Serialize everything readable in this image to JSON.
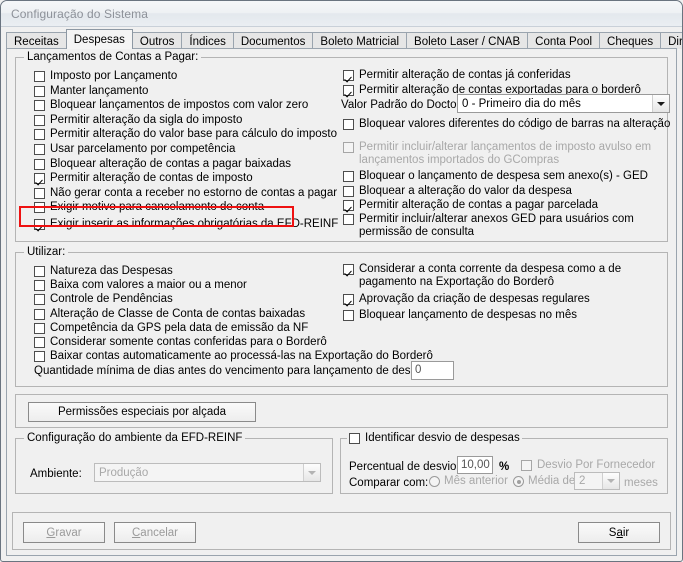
{
  "window": {
    "title": "Configuração do Sistema"
  },
  "tabs": [
    {
      "label": "Receitas",
      "active": false
    },
    {
      "label": "Despesas",
      "active": true
    },
    {
      "label": "Outros",
      "active": false
    },
    {
      "label": "Índices",
      "active": false
    },
    {
      "label": "Documentos",
      "active": false
    },
    {
      "label": "Boleto Matricial",
      "active": false
    },
    {
      "label": "Boleto Laser / CNAB",
      "active": false
    },
    {
      "label": "Conta Pool",
      "active": false
    },
    {
      "label": "Cheques",
      "active": false
    },
    {
      "label": "Diretórios",
      "active": false
    }
  ],
  "group_lancamentos": {
    "legend": "Lançamentos de Contas a Pagar:",
    "left_checkboxes": [
      {
        "label": "Imposto por Lançamento",
        "checked": false
      },
      {
        "label": "Manter lançamento",
        "checked": false
      },
      {
        "label": "Bloquear lançamentos de impostos com valor zero",
        "checked": false
      },
      {
        "label": "Permitir alteração da sigla do imposto",
        "checked": false
      },
      {
        "label": "Permitir alteração do valor base para cálculo do imposto",
        "checked": false
      },
      {
        "label": "Usar parcelamento por competência",
        "checked": false
      },
      {
        "label": "Bloquear alteração de contas a pagar baixadas",
        "checked": false
      },
      {
        "label": "Permitir alteração de contas de imposto",
        "checked": true
      },
      {
        "label": "Não gerar conta a receber no estorno de contas a pagar",
        "checked": false
      },
      {
        "label": "Exigir motivo para cancelamento de conta",
        "checked": false
      }
    ],
    "highlighted_checkbox": {
      "label": "Exigir inserir as informações obrigatórias da EFD-REINF",
      "checked": true
    },
    "right_checkboxes_top": [
      {
        "label": "Permitir alteração de contas já conferidas",
        "checked": true
      },
      {
        "label": "Permitir alteração de contas exportadas para o borderô",
        "checked": true
      }
    ],
    "valor_padrao_label": "Valor Padrão do Docto.",
    "valor_padrao_value": "0 - Primeiro dia do mês",
    "bloquear_valores": {
      "label": "Bloquear valores diferentes do código de barras na alteração",
      "checked": false
    },
    "gcompras": {
      "line1": "Permitir incluir/alterar lançamentos de imposto avulso em",
      "line2": "lançamentos importados do GCompras",
      "checked": false,
      "disabled": true
    },
    "right_checkboxes_bottom": [
      {
        "label": "Bloquear o lançamento de despesa sem anexo(s) - GED",
        "checked": false
      },
      {
        "label": "Bloquear a alteração do valor da despesa",
        "checked": false
      },
      {
        "label": "Permitir alteração de contas a pagar parcelada",
        "checked": true
      }
    ],
    "anexos_ged": {
      "line1": "Permitir incluir/alterar anexos GED para usuários com",
      "line2": "permissão de consulta",
      "checked": false
    }
  },
  "group_utilizar": {
    "legend": "Utilizar:",
    "left_checkboxes": [
      {
        "label": "Natureza das Despesas",
        "checked": false
      },
      {
        "label": "Baixa com valores a maior ou a menor",
        "checked": false
      },
      {
        "label": "Controle de Pendências",
        "checked": false
      },
      {
        "label": "Alteração de Classe de Conta de contas baixadas",
        "checked": false
      },
      {
        "label": "Competência da GPS pela data de emissão da NF",
        "checked": false
      },
      {
        "label": "Considerar somente contas conferidas para o Borderô",
        "checked": false
      },
      {
        "label": "Baixar contas automaticamente ao processá-las na Exportação do Borderô",
        "checked": false
      }
    ],
    "conta_corrente": {
      "line1": "Considerar a conta corrente da despesa como a de",
      "line2": "pagamento na Exportação do Borderô",
      "checked": true
    },
    "right_checkboxes": [
      {
        "label": "Aprovação da criação de despesas regulares",
        "checked": true
      },
      {
        "label": "Bloquear lançamento de despesas no mês",
        "checked": false
      }
    ],
    "quantidade_label": "Quantidade mínima de dias antes do vencimento para lançamento de despesa:",
    "quantidade_value": "0"
  },
  "permissoes_button": {
    "label": "Permissões especiais por alçada"
  },
  "group_efd_reinf": {
    "legend": "Configuração do ambiente da EFD-REINF",
    "ambiente_label": "Ambiente:",
    "ambiente_value": "Produção",
    "ambiente_disabled": true
  },
  "group_desvio": {
    "checkbox_label": "Identificar desvio de despesas",
    "checkbox_checked": false,
    "percentual_label": "Percentual de desvio",
    "percentual_value": "10,00",
    "percent_sign": "%",
    "fornecedor": {
      "label": "Desvio Por Fornecedor",
      "checked": false,
      "disabled": true
    },
    "comparar_label": "Comparar com:",
    "radio_mes_anterior": {
      "label": "Mês anterior",
      "selected": false
    },
    "radio_media_de": {
      "label": "Média de",
      "selected": true
    },
    "media_value": "2",
    "meses_label": "meses"
  },
  "footer": {
    "gravar": {
      "label": "Gravar",
      "accel": "G",
      "disabled": true
    },
    "cancelar": {
      "label": "Cancelar",
      "accel": "C",
      "disabled": true
    },
    "sair": {
      "label": "Sair",
      "accel": "a",
      "disabled": false
    }
  }
}
